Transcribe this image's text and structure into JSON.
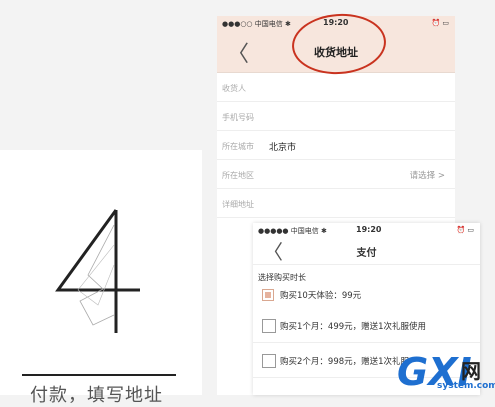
{
  "left_card": {
    "digit": "4",
    "caption": "付款，填写地址"
  },
  "address_screen": {
    "status": {
      "carrier": "●●●○○ 中国电信 ✱",
      "time": "19:20",
      "right": "⏰ ▭"
    },
    "back": "〈",
    "title": "收货地址",
    "fields": [
      {
        "label": "收货人",
        "value": ""
      },
      {
        "label": "手机号码",
        "value": ""
      },
      {
        "label": "所在城市",
        "value": "北京市"
      },
      {
        "label": "所在地区",
        "value": "",
        "select": "请选择 >"
      },
      {
        "label": "详细地址",
        "value": ""
      }
    ]
  },
  "pay_screen": {
    "status": {
      "carrier": "●●●●● 中国电信 ✱",
      "time": "19:20",
      "right": "⏰ ▭"
    },
    "back": "〈",
    "title": "支付",
    "section": "选择购买时长",
    "options": [
      {
        "text": "购买10天体验：99元",
        "checked": true
      },
      {
        "text": "购买1个月：499元，赠送1次礼服使用",
        "checked": false
      },
      {
        "text": "购买2个月：998元，赠送1次礼服",
        "checked": false
      }
    ]
  },
  "watermark": {
    "logo": "GXI",
    "cn": "网",
    "url": "system.com"
  },
  "colors": {
    "accent_header": "#f7e6dd",
    "annotation_red": "#c9331f",
    "checked_fill": "#e6b39e",
    "watermark_blue": "#1e6fd0"
  }
}
